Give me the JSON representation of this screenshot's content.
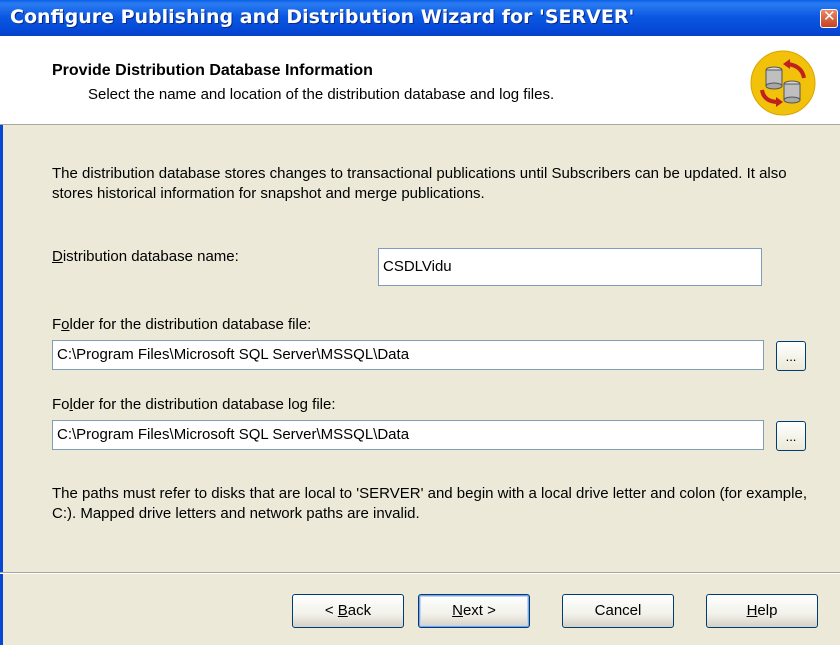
{
  "window": {
    "title": "Configure Publishing and Distribution Wizard for 'SERVER'",
    "close_icon": "close-x"
  },
  "header": {
    "title": "Provide Distribution Database Information",
    "subtitle": "Select the name and location of the distribution database and log files.",
    "icon": "database-replication-icon"
  },
  "body": {
    "description": "The distribution database stores changes to transactional publications until Subscribers can be updated. It also stores historical information for snapshot and merge publications.",
    "db_name": {
      "label_accel": "D",
      "label_rest": "istribution database name:",
      "value": "CSDLVidu"
    },
    "data_folder": {
      "label_pre": "F",
      "label_accel": "o",
      "label_rest": "lder for the distribution database file:",
      "value": "C:\\Program Files\\Microsoft SQL Server\\MSSQL\\Data",
      "browse_label": "..."
    },
    "log_folder": {
      "label_pre": "Fo",
      "label_accel": "l",
      "label_rest": "der for the distribution database log file:",
      "value": "C:\\Program Files\\Microsoft SQL Server\\MSSQL\\Data",
      "browse_label": "..."
    },
    "paths_note": "The paths must refer to disks that are local to 'SERVER' and begin with a local drive letter and colon (for example, C:). Mapped drive letters and network paths are invalid."
  },
  "buttons": {
    "back": {
      "prefix": "< ",
      "accel": "B",
      "rest": "ack"
    },
    "next": {
      "accel": "N",
      "rest": "ext >"
    },
    "cancel": "Cancel",
    "help": {
      "accel": "H",
      "rest": "elp"
    }
  },
  "colors": {
    "titlebar": "#0548d6",
    "dialog_bg": "#ece9d8",
    "close_button": "#c6421e"
  }
}
